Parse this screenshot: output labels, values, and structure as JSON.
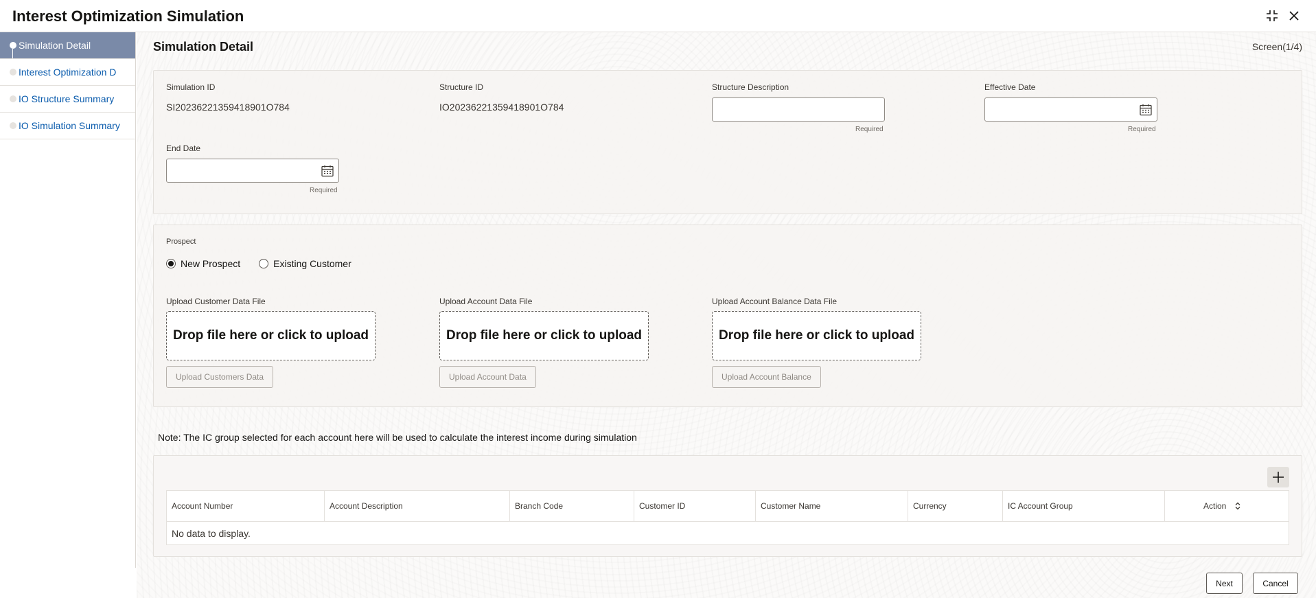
{
  "app": {
    "title": "Interest Optimization Simulation"
  },
  "sidebar": {
    "items": [
      {
        "label": "Simulation Detail",
        "active": true
      },
      {
        "label": "Interest Optimization D",
        "active": false
      },
      {
        "label": "IO Structure Summary",
        "active": false
      },
      {
        "label": "IO Simulation Summary",
        "active": false
      }
    ]
  },
  "page": {
    "title": "Simulation Detail",
    "screen_indicator": "Screen(1/4)"
  },
  "details": {
    "simulation_id": {
      "label": "Simulation ID",
      "value": "SI20236221359418901O784"
    },
    "structure_id": {
      "label": "Structure ID",
      "value": "IO20236221359418901O784"
    },
    "structure_description": {
      "label": "Structure Description",
      "value": "",
      "hint": "Required"
    },
    "effective_date": {
      "label": "Effective Date",
      "value": "",
      "hint": "Required"
    },
    "end_date": {
      "label": "End Date",
      "value": "",
      "hint": "Required"
    }
  },
  "prospect": {
    "label": "Prospect",
    "options": [
      {
        "label": "New Prospect",
        "selected": true
      },
      {
        "label": "Existing Customer",
        "selected": false
      }
    ]
  },
  "uploads": [
    {
      "label": "Upload Customer Data File",
      "drop_text": "Drop file here or click to upload",
      "button": "Upload Customers Data"
    },
    {
      "label": "Upload Account Data File",
      "drop_text": "Drop file here or click to upload",
      "button": "Upload Account Data"
    },
    {
      "label": "Upload Account Balance Data File",
      "drop_text": "Drop file here or click to upload",
      "button": "Upload Account Balance"
    }
  ],
  "note": "Note: The IC group selected for each account here will be used to calculate the interest income during simulation",
  "table": {
    "columns": [
      "Account Number",
      "Account Description",
      "Branch Code",
      "Customer ID",
      "Customer Name",
      "Currency",
      "IC Account Group",
      "Action"
    ],
    "empty_text": "No data to display."
  },
  "footer": {
    "next": "Next",
    "cancel": "Cancel"
  },
  "icons": {
    "minimize": "minimize-icon",
    "close": "close-icon",
    "calendar": "calendar-icon",
    "add": "plus-icon",
    "sort": "sort-icon"
  }
}
